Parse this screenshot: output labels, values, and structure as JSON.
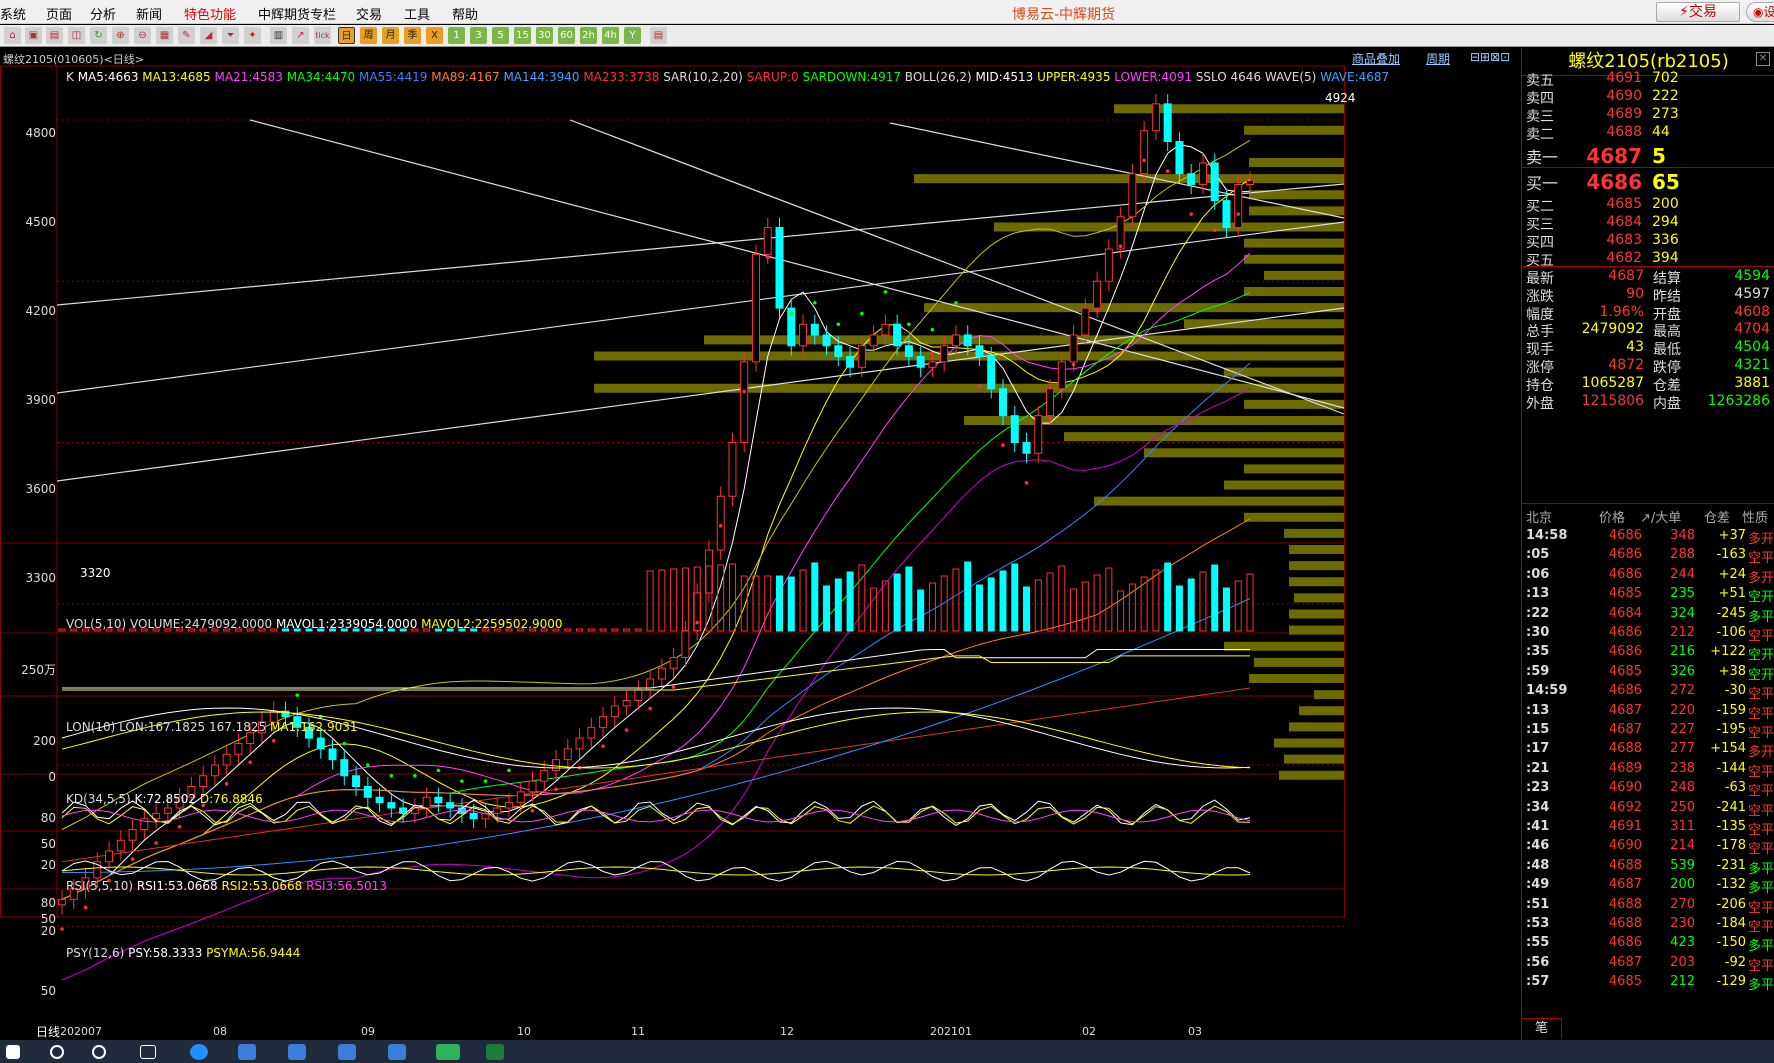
{
  "menu": {
    "items": [
      "系统",
      "页面",
      "分析",
      "新闻",
      "特色功能",
      "中辉期货专栏",
      "交易",
      "工具",
      "帮助"
    ],
    "active": "特色功能"
  },
  "app_title": "博易云-中辉期货",
  "trade_button": "交易",
  "search_button": "设",
  "chart_header": {
    "symbol_label": "螺纹2105(010605)<日线>",
    "overlay_label": "商品叠加",
    "period_label": "周期"
  },
  "main_indicators": [
    {
      "text": "K",
      "color": "#dddddd"
    },
    {
      "text": "MA5:4663",
      "color": "#ffffff"
    },
    {
      "text": "MA13:4685",
      "color": "#ffff00"
    },
    {
      "text": "MA21:4583",
      "color": "#ff40ff"
    },
    {
      "text": "MA34:4470",
      "color": "#00ff00"
    },
    {
      "text": "MA55:4419",
      "color": "#4080ff"
    },
    {
      "text": "MA89:4167",
      "color": "#ff8020"
    },
    {
      "text": "MA144:3940",
      "color": "#40a0ff"
    },
    {
      "text": "MA233:3738",
      "color": "#ff3030"
    },
    {
      "text": "SAR(10,2,20)",
      "color": "#dddddd"
    },
    {
      "text": "SARUP:0",
      "color": "#ff3030"
    },
    {
      "text": "SARDOWN:4917",
      "color": "#00ff00"
    },
    {
      "text": "BOLL(26,2)",
      "color": "#dddddd"
    },
    {
      "text": "MID:4513",
      "color": "#ffffff"
    },
    {
      "text": "UPPER:4935",
      "color": "#ffff00"
    },
    {
      "text": "LOWER:4091",
      "color": "#ff40ff"
    },
    {
      "text": "SSLO 4646",
      "color": "#dddddd"
    },
    {
      "text": "WAVE(5)",
      "color": "#dddddd"
    },
    {
      "text": "WAVE:4687",
      "color": "#40a0ff"
    }
  ],
  "price_axis": [
    "4800",
    "4500",
    "4200",
    "3900",
    "3600",
    "3300"
  ],
  "price_high_label": "4924",
  "price_low_label": "3320",
  "vol_panel": {
    "title": "VOL(5,10)",
    "items": [
      {
        "text": "VOLUME:2479092.0000",
        "color": "#dddddd"
      },
      {
        "text": "MAVOL1:2339054.0000",
        "color": "#ffffff"
      },
      {
        "text": "MAVOL2:2259502.9000",
        "color": "#ffff00"
      }
    ],
    "axis": [
      "250万"
    ]
  },
  "lon_panel": {
    "title": "LON(10)",
    "items": [
      {
        "text": "LON:167.1825",
        "color": "#dddddd"
      },
      {
        "text": "167.1825",
        "color": "#dddddd"
      },
      {
        "text": "MA1:162.9031",
        "color": "#ffff00"
      }
    ],
    "axis": [
      "200",
      "0"
    ]
  },
  "kd_panel": {
    "title": "KD(34,5,5)",
    "items": [
      {
        "text": "K:72.8502",
        "color": "#ffffff"
      },
      {
        "text": "D:76.8846",
        "color": "#ffff00"
      }
    ],
    "axis": [
      "80",
      "50",
      "20"
    ]
  },
  "rsi_panel": {
    "title": "RSI(5,5,10)",
    "items": [
      {
        "text": "RSI1:53.0668",
        "color": "#ffffff"
      },
      {
        "text": "RSI2:53.0668",
        "color": "#ffff00"
      },
      {
        "text": "RSI3:56.5013",
        "color": "#ff40ff"
      }
    ],
    "axis": [
      "80",
      "50",
      "20"
    ]
  },
  "psy_panel": {
    "title": "PSY(12,6)",
    "items": [
      {
        "text": "PSY:58.3333",
        "color": "#ffffff"
      },
      {
        "text": "PSYMA:56.9444",
        "color": "#ffff00"
      }
    ],
    "axis": [
      "50"
    ]
  },
  "date_axis": {
    "label": "日线",
    "ticks": [
      "202007",
      "08",
      "09",
      "10",
      "11",
      "12",
      "202101",
      "02",
      "03"
    ]
  },
  "quote": {
    "title": "螺纹2105(rb2105)",
    "asks": [
      {
        "label": "卖五",
        "price": "4691",
        "vol": "702"
      },
      {
        "label": "卖四",
        "price": "4690",
        "vol": "222"
      },
      {
        "label": "卖三",
        "price": "4689",
        "vol": "273"
      },
      {
        "label": "卖二",
        "price": "4688",
        "vol": "44"
      },
      {
        "label": "卖一",
        "price": "4687",
        "vol": "5"
      }
    ],
    "bids": [
      {
        "label": "买一",
        "price": "4686",
        "vol": "65"
      },
      {
        "label": "买二",
        "price": "4685",
        "vol": "200"
      },
      {
        "label": "买三",
        "price": "4684",
        "vol": "294"
      },
      {
        "label": "买四",
        "price": "4683",
        "vol": "336"
      },
      {
        "label": "买五",
        "price": "4682",
        "vol": "394"
      }
    ],
    "stats": [
      {
        "l1": "最新",
        "v1": "4687",
        "c1": "#ff3333",
        "l2": "结算",
        "v2": "4594",
        "c2": "#00ff00"
      },
      {
        "l1": "涨跌",
        "v1": "90",
        "c1": "#ff3333",
        "l2": "昨结",
        "v2": "4597",
        "c2": "#dddddd"
      },
      {
        "l1": "幅度",
        "v1": "1.96%",
        "c1": "#ff3333",
        "l2": "开盘",
        "v2": "4608",
        "c2": "#ff3333"
      },
      {
        "l1": "总手",
        "v1": "2479092",
        "c1": "#ffff00",
        "l2": "最高",
        "v2": "4704",
        "c2": "#ff3333"
      },
      {
        "l1": "现手",
        "v1": "43",
        "c1": "#ffff00",
        "l2": "最低",
        "v2": "4504",
        "c2": "#00ff00"
      },
      {
        "l1": "涨停",
        "v1": "4872",
        "c1": "#ff3333",
        "l2": "跌停",
        "v2": "4321",
        "c2": "#00ff00"
      },
      {
        "l1": "持仓",
        "v1": "1065287",
        "c1": "#ffff00",
        "l2": "仓差",
        "v2": "3881",
        "c2": "#ffff00"
      },
      {
        "l1": "外盘",
        "v1": "1215806",
        "c1": "#ff3333",
        "l2": "内盘",
        "v2": "1263286",
        "c2": "#00ff00"
      }
    ],
    "ticks_header": {
      "time": "北京",
      "price": "价格",
      "vol": "↗/大单",
      "diff": "仓差",
      "nature": "性质"
    },
    "ticks": [
      {
        "t": "14:58",
        "p": "4686",
        "v": "348",
        "d": "+37",
        "n": "多开",
        "vc": "#ff3333",
        "dc": "#ffff00",
        "nc": "#ff3333"
      },
      {
        "t": ":05",
        "p": "4686",
        "v": "288",
        "d": "-163",
        "n": "空平",
        "vc": "#ff3333",
        "dc": "#ffff00",
        "nc": "#ff3333"
      },
      {
        "t": ":06",
        "p": "4686",
        "v": "244",
        "d": "+24",
        "n": "多开",
        "vc": "#ff3333",
        "dc": "#ffff00",
        "nc": "#ff3333"
      },
      {
        "t": ":13",
        "p": "4685",
        "v": "235",
        "d": "+51",
        "n": "空开",
        "vc": "#00ff00",
        "dc": "#ffff00",
        "nc": "#00ff00"
      },
      {
        "t": ":22",
        "p": "4684",
        "v": "324",
        "d": "-245",
        "n": "多平",
        "vc": "#00ff00",
        "dc": "#ffff00",
        "nc": "#00ff00"
      },
      {
        "t": ":30",
        "p": "4686",
        "v": "212",
        "d": "-106",
        "n": "空平",
        "vc": "#ff3333",
        "dc": "#ffff00",
        "nc": "#ff3333"
      },
      {
        "t": ":35",
        "p": "4686",
        "v": "216",
        "d": "+122",
        "n": "空开",
        "vc": "#00ff00",
        "dc": "#ffff00",
        "nc": "#00ff00"
      },
      {
        "t": ":59",
        "p": "4685",
        "v": "326",
        "d": "+38",
        "n": "空开",
        "vc": "#00ff00",
        "dc": "#ffff00",
        "nc": "#00ff00"
      },
      {
        "t": "14:59",
        "p": "4686",
        "v": "272",
        "d": "-30",
        "n": "空平",
        "vc": "#ff3333",
        "dc": "#ffff00",
        "nc": "#ff3333"
      },
      {
        "t": ":13",
        "p": "4687",
        "v": "220",
        "d": "-159",
        "n": "空平",
        "vc": "#ff3333",
        "dc": "#ffff00",
        "nc": "#ff3333"
      },
      {
        "t": ":15",
        "p": "4687",
        "v": "227",
        "d": "-195",
        "n": "空平",
        "vc": "#ff3333",
        "dc": "#ffff00",
        "nc": "#ff3333"
      },
      {
        "t": ":17",
        "p": "4688",
        "v": "277",
        "d": "+154",
        "n": "多开",
        "vc": "#ff3333",
        "dc": "#ffff00",
        "nc": "#ff3333"
      },
      {
        "t": ":21",
        "p": "4689",
        "v": "238",
        "d": "-144",
        "n": "空平",
        "vc": "#ff3333",
        "dc": "#ffff00",
        "nc": "#ff3333"
      },
      {
        "t": ":23",
        "p": "4690",
        "v": "248",
        "d": "-63",
        "n": "空平",
        "vc": "#ff3333",
        "dc": "#ffff00",
        "nc": "#ff3333"
      },
      {
        "t": ":34",
        "p": "4692",
        "v": "250",
        "d": "-241",
        "n": "空平",
        "vc": "#ff3333",
        "dc": "#ffff00",
        "nc": "#ff3333"
      },
      {
        "t": ":41",
        "p": "4691",
        "v": "311",
        "d": "-135",
        "n": "空平",
        "vc": "#ff3333",
        "dc": "#ffff00",
        "nc": "#ff3333"
      },
      {
        "t": ":46",
        "p": "4690",
        "v": "214",
        "d": "-178",
        "n": "空平",
        "vc": "#ff3333",
        "dc": "#ffff00",
        "nc": "#ff3333"
      },
      {
        "t": ":48",
        "p": "4688",
        "v": "539",
        "d": "-231",
        "n": "多平",
        "vc": "#00ff00",
        "dc": "#ffff00",
        "nc": "#00ff00"
      },
      {
        "t": ":49",
        "p": "4687",
        "v": "200",
        "d": "-132",
        "n": "多平",
        "vc": "#00ff00",
        "dc": "#ffff00",
        "nc": "#00ff00"
      },
      {
        "t": ":51",
        "p": "4688",
        "v": "270",
        "d": "-206",
        "n": "空平",
        "vc": "#ff3333",
        "dc": "#ffff00",
        "nc": "#ff3333"
      },
      {
        "t": ":53",
        "p": "4688",
        "v": "230",
        "d": "-184",
        "n": "空平",
        "vc": "#ff3333",
        "dc": "#ffff00",
        "nc": "#ff3333"
      },
      {
        "t": ":55",
        "p": "4686",
        "v": "423",
        "d": "-150",
        "n": "多平",
        "vc": "#00ff00",
        "dc": "#ffff00",
        "nc": "#00ff00"
      },
      {
        "t": ":56",
        "p": "4687",
        "v": "203",
        "d": "-92",
        "n": "空平",
        "vc": "#ff3333",
        "dc": "#ffff00",
        "nc": "#ff3333"
      },
      {
        "t": ":57",
        "p": "4685",
        "v": "212",
        "d": "-129",
        "n": "多平",
        "vc": "#00ff00",
        "dc": "#ffff00",
        "nc": "#00ff00"
      }
    ],
    "footer_tab": "笔"
  },
  "toolbar_labels": [
    "日",
    "周",
    "月",
    "季",
    "X",
    "1",
    "3",
    "5",
    "15",
    "30",
    "60",
    "2h",
    "4h",
    "Y"
  ],
  "chart_data": {
    "type": "candlestick",
    "price_range": [
      3200,
      4980
    ],
    "close_series": [
      3350,
      3370,
      3390,
      3420,
      3440,
      3460,
      3480,
      3500,
      3510,
      3520,
      3540,
      3560,
      3580,
      3600,
      3620,
      3640,
      3660,
      3680,
      3700,
      3690,
      3670,
      3650,
      3630,
      3610,
      3580,
      3560,
      3540,
      3530,
      3520,
      3510,
      3520,
      3540,
      3530,
      3520,
      3510,
      3500,
      3510,
      3520,
      3530,
      3550,
      3570,
      3590,
      3610,
      3630,
      3650,
      3670,
      3690,
      3710,
      3720,
      3740,
      3760,
      3780,
      3800,
      3850,
      3920,
      4000,
      4100,
      4200,
      4350,
      4550,
      4600,
      4450,
      4380,
      4420,
      4400,
      4380,
      4360,
      4340,
      4380,
      4400,
      4420,
      4380,
      4360,
      4340,
      4350,
      4380,
      4400,
      4380,
      4360,
      4300,
      4250,
      4200,
      4180,
      4250,
      4300,
      4350,
      4400,
      4450,
      4500,
      4560,
      4620,
      4700,
      4780,
      4830,
      4760,
      4700,
      4680,
      4720,
      4650,
      4600,
      4680,
      4687
    ]
  }
}
